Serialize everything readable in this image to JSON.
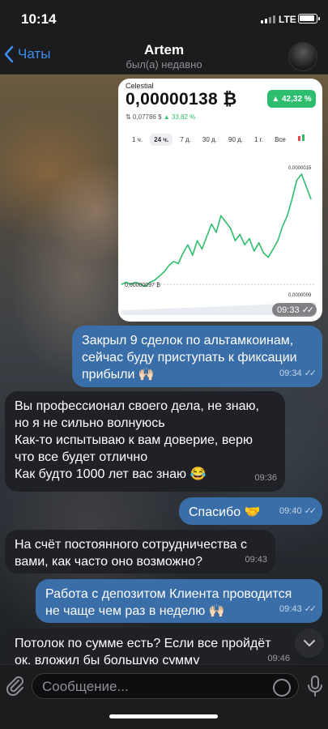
{
  "status_bar": {
    "time": "10:14",
    "network": "LTE"
  },
  "header": {
    "back_label": "Чаты",
    "title": "Artem",
    "subtitle": "был(а) недавно"
  },
  "image_message": {
    "coin_name": "Celestial",
    "price": "0,00000138 ₿",
    "change_badge": "▲ 42,32 %",
    "sub_price": "⇅ 0,07786 $",
    "sub_change": "▲ 33,82 %",
    "ranges": [
      "1 ч.",
      "24 ч.",
      "7 д.",
      "30 д.",
      "90 д.",
      "1 г.",
      "Все"
    ],
    "active_range": "24 ч.",
    "max_label": "0,0000015",
    "min_label": "0,0000009",
    "start_label": "0,00000097 ₿",
    "time": "09:33"
  },
  "chart_data": {
    "type": "line",
    "y": [
      9.7e-07,
      9.8e-07,
      9.7e-07,
      9.8e-07,
      9.7e-07,
      9.6e-07,
      9.8e-07,
      9.9e-07,
      1.01e-06,
      1.03e-06,
      1.06e-06,
      1.08e-06,
      1.07e-06,
      1.12e-06,
      1.16e-06,
      1.11e-06,
      1.18e-06,
      1.14e-06,
      1.2e-06,
      1.26e-06,
      1.22e-06,
      1.3e-06,
      1.27e-06,
      1.24e-06,
      1.18e-06,
      1.21e-06,
      1.16e-06,
      1.19e-06,
      1.13e-06,
      1.17e-06,
      1.12e-06,
      1.1e-06,
      1.14e-06,
      1.18e-06,
      1.25e-06,
      1.3e-06,
      1.38e-06,
      1.47e-06,
      1.5e-06,
      1.44e-06,
      1.38e-06
    ],
    "ylim": [
      9e-07,
      1.5e-06
    ]
  },
  "messages": [
    {
      "dir": "out",
      "text": "Закрыл 9 сделок по альтамкоинам, сейчас буду приступать к фиксации прибыли 🙌🏻",
      "time": "09:34"
    },
    {
      "dir": "in",
      "text": "Вы профессионал своего дела, не знаю, но я не сильно волнуюсь\nКак-то испытываю к вам доверие, верю что все будет отлично\nКак будто 1000 лет вас знаю 😂",
      "time": "09:36"
    },
    {
      "dir": "out",
      "text": "Спасибо 🤝",
      "time": "09:40"
    },
    {
      "dir": "in",
      "text": "На счёт постоянного сотрудничества с вами, как часто оно возможно?",
      "time": "09:43"
    },
    {
      "dir": "out",
      "text": "Работа с депозитом Клиента проводится не чаще чем раз в неделю 🙌🏻",
      "time": "09:43"
    },
    {
      "dir": "in",
      "text": "Потолок по сумме есть? Если все пройдёт ок, вложил бы большую сумму",
      "time": "09:46"
    }
  ],
  "composer": {
    "placeholder": "Сообщение..."
  },
  "colors": {
    "accent": "#3e8ef0",
    "outgoing": "#3a6ea8",
    "incoming": "#1f2126",
    "chart_green": "#2ebd6d"
  }
}
